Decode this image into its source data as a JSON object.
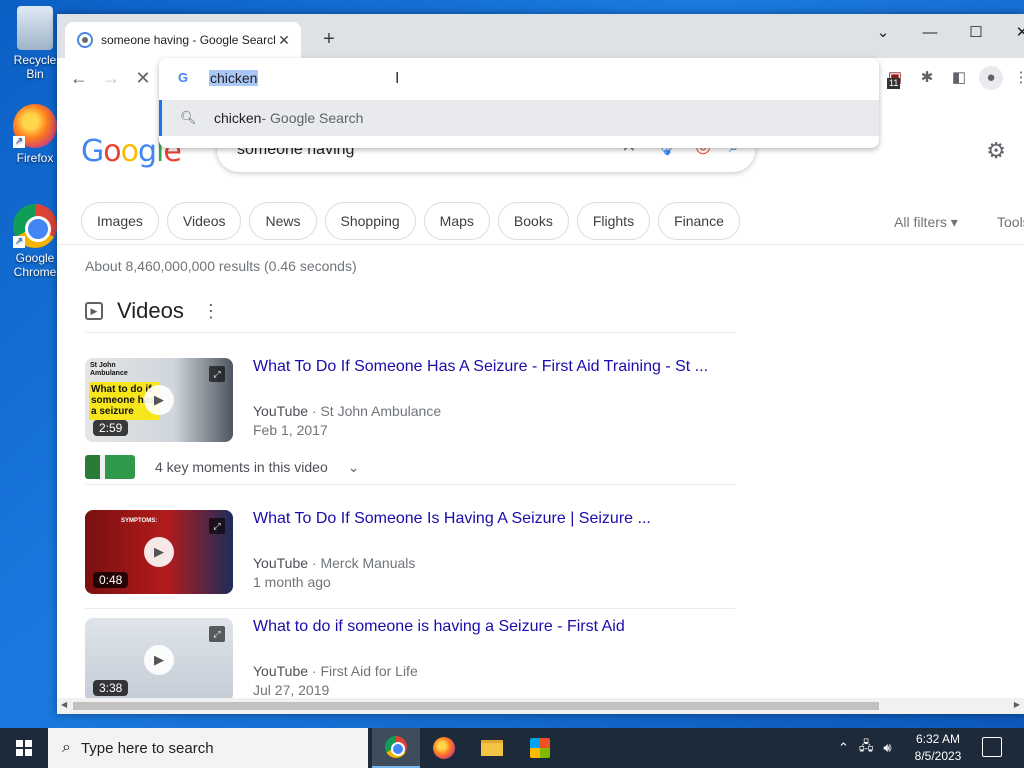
{
  "desktop": {
    "icons": [
      {
        "label": "Recycle Bin"
      },
      {
        "label": "Firefox"
      },
      {
        "label": "Google Chrome"
      }
    ]
  },
  "browser": {
    "tab_title": "someone having - Google Search",
    "omnibox": {
      "value": "chicken",
      "suggestion_query": "chicken",
      "suggestion_suffix": " - Google Search"
    },
    "extension_badge": "11"
  },
  "google": {
    "logo": [
      "G",
      "o",
      "o",
      "g",
      "l",
      "e"
    ],
    "query": "someone having",
    "chips": [
      "Images",
      "Videos",
      "News",
      "Shopping",
      "Maps",
      "Books",
      "Flights",
      "Finance"
    ],
    "all_filters": "All filters",
    "tools": "Tools",
    "result_stats": "About 8,460,000,000 results (0.46 seconds)",
    "videos_heading": "Videos",
    "key_moments": "4 key moments in this video",
    "videos": [
      {
        "title": "What To Do If Someone Has A Seizure - First Aid Training - St ...",
        "source": "YouTube",
        "channel": "St John Ambulance",
        "date": "Feb 1, 2017",
        "duration": "2:59",
        "thumb_text": "What to do if someone has a seizure",
        "thumb_brand": "St John Ambulance"
      },
      {
        "title": "What To Do If Someone Is Having A Seizure | Seizure ...",
        "source": "YouTube",
        "channel": "Merck Manuals",
        "date": "1 month ago",
        "duration": "0:48",
        "thumb_text": "SYMPTOMS:"
      },
      {
        "title": "What to do if someone is having a Seizure - First Aid",
        "source": "YouTube",
        "channel": "First Aid for Life",
        "date": "Jul 27, 2019",
        "duration": "3:38"
      }
    ]
  },
  "taskbar": {
    "search_placeholder": "Type here to search",
    "time": "6:32 AM",
    "date": "8/5/2023"
  }
}
